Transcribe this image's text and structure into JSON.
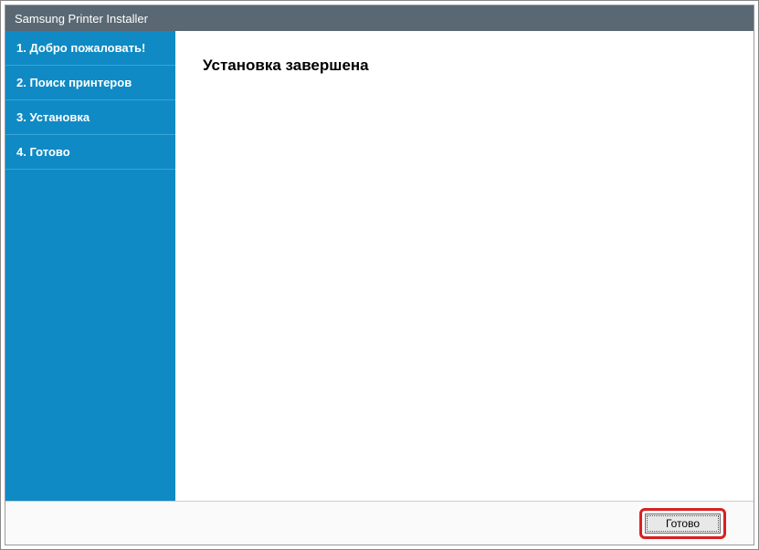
{
  "window": {
    "title": "Samsung Printer Installer"
  },
  "sidebar": {
    "items": [
      {
        "label": "1. Добро пожаловать!"
      },
      {
        "label": "2. Поиск принтеров"
      },
      {
        "label": "3. Установка"
      },
      {
        "label": "4. Готово"
      }
    ]
  },
  "main": {
    "heading": "Установка завершена"
  },
  "footer": {
    "finish_label": "Готово"
  }
}
